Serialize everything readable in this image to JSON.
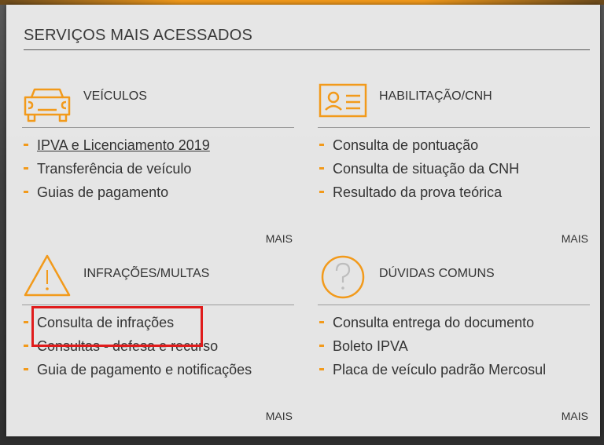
{
  "colors": {
    "accent": "#f29a1b",
    "highlight": "#e01c1c"
  },
  "panel": {
    "title": "SERVIÇOS MAIS ACESSADOS"
  },
  "sections": [
    {
      "title": "VEÍCULOS",
      "icon": "car-icon",
      "links": [
        "IPVA e Licenciamento 2019",
        "Transferência de veículo",
        "Guias de pagamento"
      ],
      "more": "MAIS"
    },
    {
      "title": "HABILITAÇÃO/CNH",
      "icon": "license-card-icon",
      "links": [
        "Consulta de pontuação",
        "Consulta de situação da CNH",
        "Resultado da prova teórica"
      ],
      "more": "MAIS"
    },
    {
      "title": "INFRAÇÕES/MULTAS",
      "icon": "warning-icon",
      "links": [
        "Consulta de infrações",
        "Consultas - defesa e recurso",
        "Guia de pagamento e notificações"
      ],
      "more": "MAIS"
    },
    {
      "title": "DÚVIDAS COMUNS",
      "icon": "question-icon",
      "links": [
        "Consulta entrega do documento",
        "Boleto IPVA",
        "Placa de veículo padrão Mercosul"
      ],
      "more": "MAIS"
    }
  ]
}
